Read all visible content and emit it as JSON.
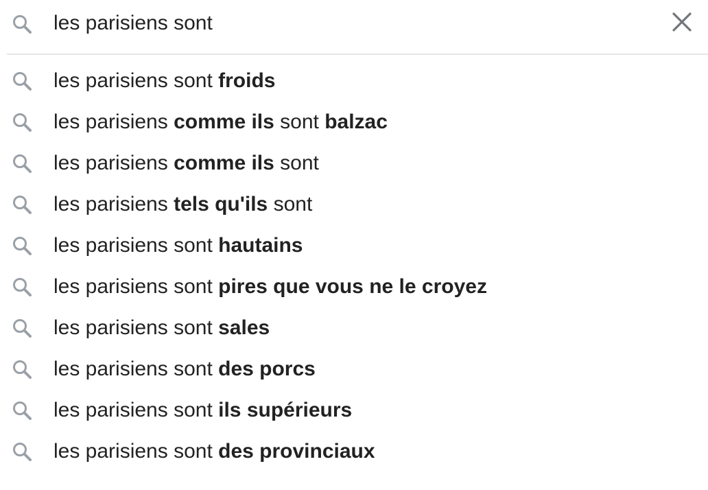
{
  "search": {
    "query": "les parisiens sont",
    "search_icon": "search-icon",
    "clear_icon": "close-icon"
  },
  "colors": {
    "text": "#222222",
    "icon": "#9aa0a6",
    "clear_icon": "#70757a",
    "divider": "#e6e6e6"
  },
  "suggestions": [
    {
      "icon": "search-icon",
      "parts": [
        {
          "text": "les parisiens sont ",
          "bold": false
        },
        {
          "text": "froids",
          "bold": true
        }
      ]
    },
    {
      "icon": "search-icon",
      "parts": [
        {
          "text": "les parisiens ",
          "bold": false
        },
        {
          "text": "comme ils",
          "bold": true
        },
        {
          "text": " sont ",
          "bold": false
        },
        {
          "text": "balzac",
          "bold": true
        }
      ]
    },
    {
      "icon": "search-icon",
      "parts": [
        {
          "text": "les parisiens ",
          "bold": false
        },
        {
          "text": "comme ils",
          "bold": true
        },
        {
          "text": " sont",
          "bold": false
        }
      ]
    },
    {
      "icon": "search-icon",
      "parts": [
        {
          "text": "les parisiens ",
          "bold": false
        },
        {
          "text": "tels qu'ils",
          "bold": true
        },
        {
          "text": " sont",
          "bold": false
        }
      ]
    },
    {
      "icon": "search-icon",
      "parts": [
        {
          "text": "les parisiens sont ",
          "bold": false
        },
        {
          "text": "hautains",
          "bold": true
        }
      ]
    },
    {
      "icon": "search-icon",
      "parts": [
        {
          "text": "les parisiens sont ",
          "bold": false
        },
        {
          "text": "pires que vous ne le croyez",
          "bold": true
        }
      ]
    },
    {
      "icon": "search-icon",
      "parts": [
        {
          "text": "les parisiens sont ",
          "bold": false
        },
        {
          "text": "sales",
          "bold": true
        }
      ]
    },
    {
      "icon": "search-icon",
      "parts": [
        {
          "text": "les parisiens sont ",
          "bold": false
        },
        {
          "text": "des porcs",
          "bold": true
        }
      ]
    },
    {
      "icon": "search-icon",
      "parts": [
        {
          "text": "les parisiens sont ",
          "bold": false
        },
        {
          "text": "ils supérieurs",
          "bold": true
        }
      ]
    },
    {
      "icon": "search-icon",
      "parts": [
        {
          "text": "les parisiens sont ",
          "bold": false
        },
        {
          "text": "des provinciaux",
          "bold": true
        }
      ]
    }
  ]
}
